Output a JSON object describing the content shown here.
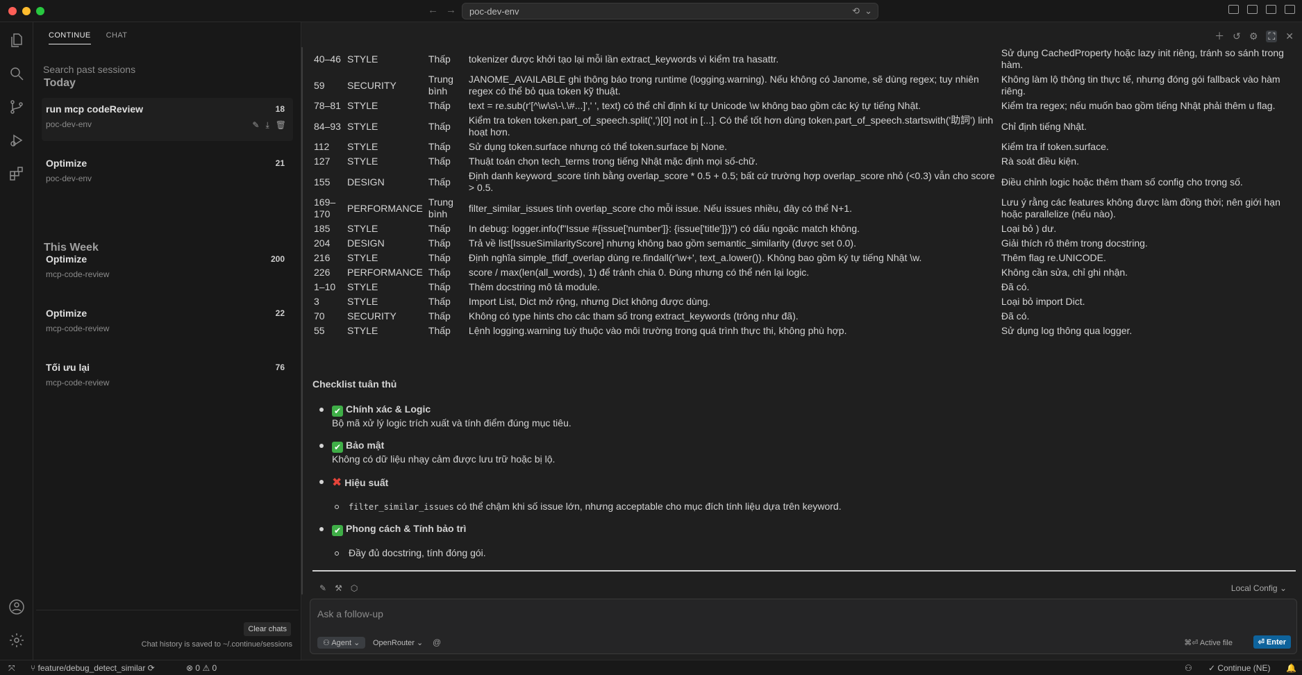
{
  "window": {
    "title": "poc-dev-env"
  },
  "sidebar": {
    "tabs": [
      {
        "label": "CONTINUE"
      },
      {
        "label": "CHAT"
      }
    ],
    "search_placeholder": "Search past sessions",
    "sections": {
      "today": "Today",
      "this_week": "This Week"
    },
    "sessions": [
      {
        "title": "run mcp codeReview",
        "workspace": "poc-dev-env",
        "count": "18"
      },
      {
        "title": "Optimize",
        "workspace": "poc-dev-env",
        "count": "21"
      },
      {
        "title": "Optimize",
        "workspace": "mcp-code-review",
        "count": "200"
      },
      {
        "title": "Optimize",
        "workspace": "mcp-code-review",
        "count": "22"
      },
      {
        "title": "Tối ưu lại",
        "workspace": "mcp-code-review",
        "count": "76"
      }
    ],
    "clear_label": "Clear chats",
    "history_note": "Chat history is saved to ~/.continue/sessions"
  },
  "issues": [
    {
      "line": "40–46",
      "type": "STYLE",
      "severity": "Thấp",
      "desc": "tokenizer được khởi tạo lại mỗi lần extract_keywords vì kiểm tra hasattr.",
      "fix": "Sử dụng CachedProperty hoặc lazy init riêng, tránh so sánh trong hàm."
    },
    {
      "line": "59",
      "type": "SECURITY",
      "severity": "Trung bình",
      "desc": "JANOME_AVAILABLE ghi thông báo trong runtime (logging.warning). Nếu không có Janome, sẽ dùng regex; tuy nhiên regex có thể bỏ qua token kỹ thuật.",
      "fix": "Không làm lộ thông tin thực tế, nhưng đóng gói fallback vào hàm riêng."
    },
    {
      "line": "78–81",
      "type": "STYLE",
      "severity": "Thấp",
      "desc": "text = re.sub(r'[^\\w\\s\\-\\.\\#...]',' ', text) có thể chỉ định kí tự Unicode \\w không bao gồm các ký tự tiếng Nhật.",
      "fix": "Kiểm tra regex; nếu muốn bao gồm tiếng Nhật phải thêm u flag."
    },
    {
      "line": "84–93",
      "type": "STYLE",
      "severity": "Thấp",
      "desc": "Kiểm tra token token.part_of_speech.split(',')[0] not in [...]. Có thể tốt hơn dùng token.part_of_speech.startswith('助詞') linh hoạt hơn.",
      "fix": "Chỉ định tiếng Nhật."
    },
    {
      "line": "112",
      "type": "STYLE",
      "severity": "Thấp",
      "desc": "Sử dụng token.surface nhưng có thể token.surface bị None.",
      "fix": "Kiểm tra if token.surface."
    },
    {
      "line": "127",
      "type": "STYLE",
      "severity": "Thấp",
      "desc": "Thuật toán chọn tech_terms trong tiếng Nhật mặc định mọi số-chữ.",
      "fix": "Rà soát điều kiện."
    },
    {
      "line": "155",
      "type": "DESIGN",
      "severity": "Thấp",
      "desc": "Định danh keyword_score tính bằng overlap_score * 0.5 + 0.5; bất cứ trường hợp overlap_score nhỏ (<0.3) vẫn cho score > 0.5.",
      "fix": "Điều chỉnh logic hoặc thêm tham số config cho trọng số."
    },
    {
      "line": "169–170",
      "type": "PERFORMANCE",
      "severity": "Trung bình",
      "desc": "filter_similar_issues tính overlap_score cho mỗi issue. Nếu issues nhiều, đây có thể N+1.",
      "fix": "Lưu ý rằng các features không được làm đồng thời; nên giới hạn hoặc parallelize (nếu nào)."
    },
    {
      "line": "185",
      "type": "STYLE",
      "severity": "Thấp",
      "desc": "In debug: logger.info(f\"Issue #{issue['number']}: {issue['title']})\") có dấu ngoặc match không.",
      "fix": "Loại bỏ ) dư."
    },
    {
      "line": "204",
      "type": "DESIGN",
      "severity": "Thấp",
      "desc": "Trả về list[IssueSimilarityScore] nhưng không bao gồm semantic_similarity (được set 0.0).",
      "fix": "Giải thích rõ thêm trong docstring."
    },
    {
      "line": "216",
      "type": "STYLE",
      "severity": "Thấp",
      "desc": "Định nghĩa simple_tfidf_overlap dùng re.findall(r'\\w+', text_a.lower()). Không bao gồm ký tự tiếng Nhật \\w.",
      "fix": "Thêm flag re.UNICODE."
    },
    {
      "line": "226",
      "type": "PERFORMANCE",
      "severity": "Thấp",
      "desc": "score / max(len(all_words), 1) để tránh chia 0. Đúng nhưng có thể nén lại logic.",
      "fix": "Không cần sửa, chỉ ghi nhận."
    },
    {
      "line": "1–10",
      "type": "STYLE",
      "severity": "Thấp",
      "desc": "Thêm docstring mô tả module.",
      "fix": "Đã có."
    },
    {
      "line": "3",
      "type": "STYLE",
      "severity": "Thấp",
      "desc": "Import List, Dict mở rộng, nhưng Dict không được dùng.",
      "fix": "Loại bỏ import Dict."
    },
    {
      "line": "70",
      "type": "SECURITY",
      "severity": "Thấp",
      "desc": "Không có type hints cho các tham số trong extract_keywords (trông như đã).",
      "fix": "Đã có."
    },
    {
      "line": "55",
      "type": "STYLE",
      "severity": "Thấp",
      "desc": "Lệnh logging.warning tuỳ thuộc vào môi trường trong quá trình thực thi, không phù hợp.",
      "fix": "Sử dụng log thông qua logger."
    }
  ],
  "checklist": {
    "title": "Checklist tuân thủ",
    "items": [
      {
        "label": "Chính xác & Logic",
        "desc": "Bộ mã xử lý logic trích xuất và tính điểm đúng mục tiêu."
      },
      {
        "label": "Bảo mật",
        "desc": "Không có dữ liệu nhạy cảm được lưu trữ hoặc bị lộ."
      },
      {
        "label": "Hiệu suất",
        "sub_code": "filter_similar_issues",
        "sub_text": " có thể chậm khi số issue lớn, nhưng acceptable cho mục đích tính liệu dựa trên keyword."
      },
      {
        "label": "Phong cách & Tính bảo trì",
        "sub_text": "Đầy đủ docstring, tính đóng gói."
      }
    ]
  },
  "composer": {
    "local_config": "Local Config",
    "placeholder": "Ask a follow-up",
    "agent_label": "Agent",
    "model_label": "OpenRouter",
    "active_file": "⌘⏎ Active file",
    "enter_label": "⏎ Enter"
  },
  "statusbar": {
    "branch": "feature/debug_detect_similar",
    "errors": "0",
    "warnings": "0",
    "continue_label": "Continue (NE)"
  }
}
